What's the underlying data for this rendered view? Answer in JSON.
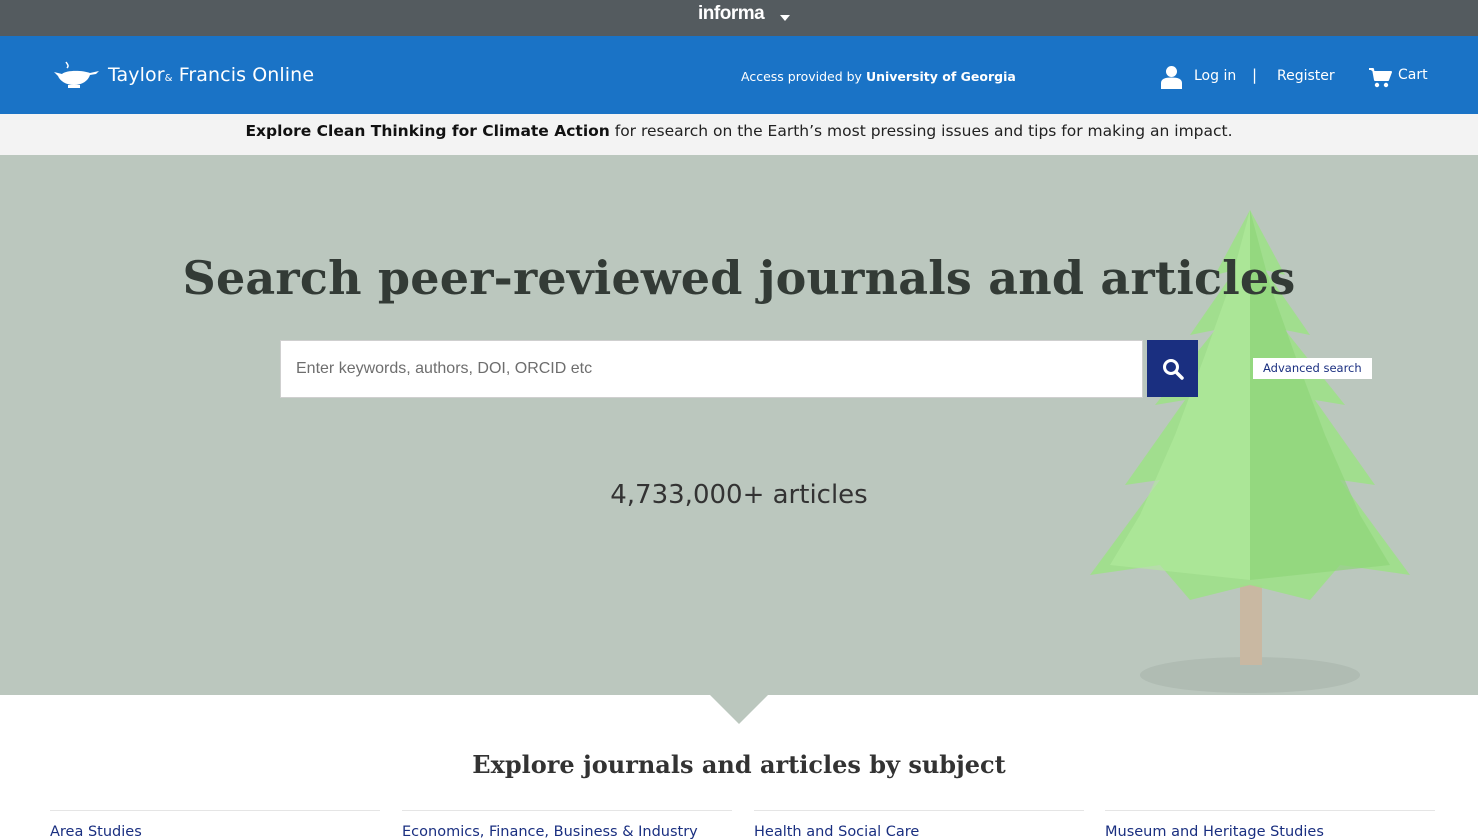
{
  "informa": {
    "label": "informa"
  },
  "header": {
    "brand": {
      "part1": "Taylor",
      "amp": "&",
      "part2": "Francis Online"
    },
    "access_prefix": "Access provided by",
    "access_institution": "University of Georgia",
    "login_label": "Log in",
    "separator": "|",
    "register_label": "Register",
    "cart_label": "Cart"
  },
  "announcement": {
    "link_text": "Explore Clean Thinking for Climate Action",
    "rest_text": " for research on the Earth’s most pressing issues and tips for making an impact."
  },
  "hero": {
    "title": "Search peer-reviewed journals and articles",
    "search_placeholder": "Enter keywords, authors, DOI, ORCID etc",
    "search_value": "",
    "advanced_search_label": "Advanced search",
    "article_count": "4,733,000+ articles"
  },
  "subjects": {
    "heading": "Explore journals and articles by subject",
    "items": [
      {
        "label": "Area Studies"
      },
      {
        "label": "Economics, Finance, Business & Industry"
      },
      {
        "label": "Health and Social Care"
      },
      {
        "label": "Museum and Heritage Studies"
      }
    ]
  },
  "colors": {
    "informa_bar": "#545b5f",
    "header_blue": "#1a73c6",
    "hero_bg": "#bbc7be",
    "search_button": "#1a2f80",
    "link_navy": "#1a2f80"
  },
  "icons": [
    "chevron-down-icon",
    "lamp-logo-icon",
    "user-icon",
    "cart-icon",
    "search-icon"
  ]
}
